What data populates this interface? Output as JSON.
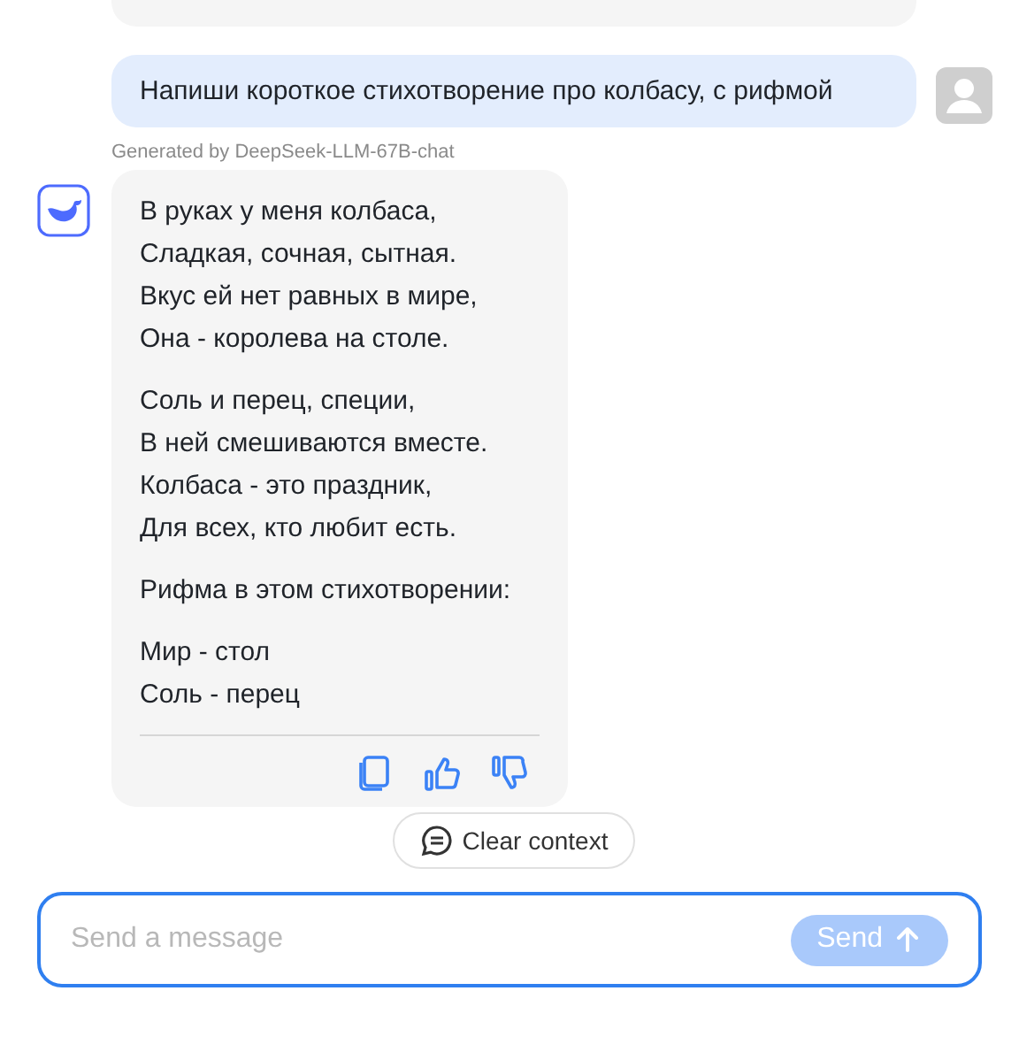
{
  "user_message": {
    "text": "Напиши короткое стихотворение про колбасу, с рифмой"
  },
  "model_caption": "Generated by DeepSeek-LLM-67B-chat",
  "bot_message": {
    "paragraphs": [
      [
        "В руках у меня колбаса,",
        "Сладкая, сочная, сытная.",
        "Вкус ей нет равных в мире,",
        "Она - королева на столе."
      ],
      [
        "Соль и перец, специи,",
        "В ней смешиваются вместе.",
        "Колбаса - это праздник,",
        "Для всех, кто любит есть."
      ],
      [
        "Рифма в этом стихотворении:"
      ],
      [
        "Мир - стол",
        "Соль - перец"
      ]
    ]
  },
  "clear_context": {
    "label": "Clear context"
  },
  "composer": {
    "placeholder": "Send a message",
    "send_label": "Send",
    "send_disabled": true
  }
}
